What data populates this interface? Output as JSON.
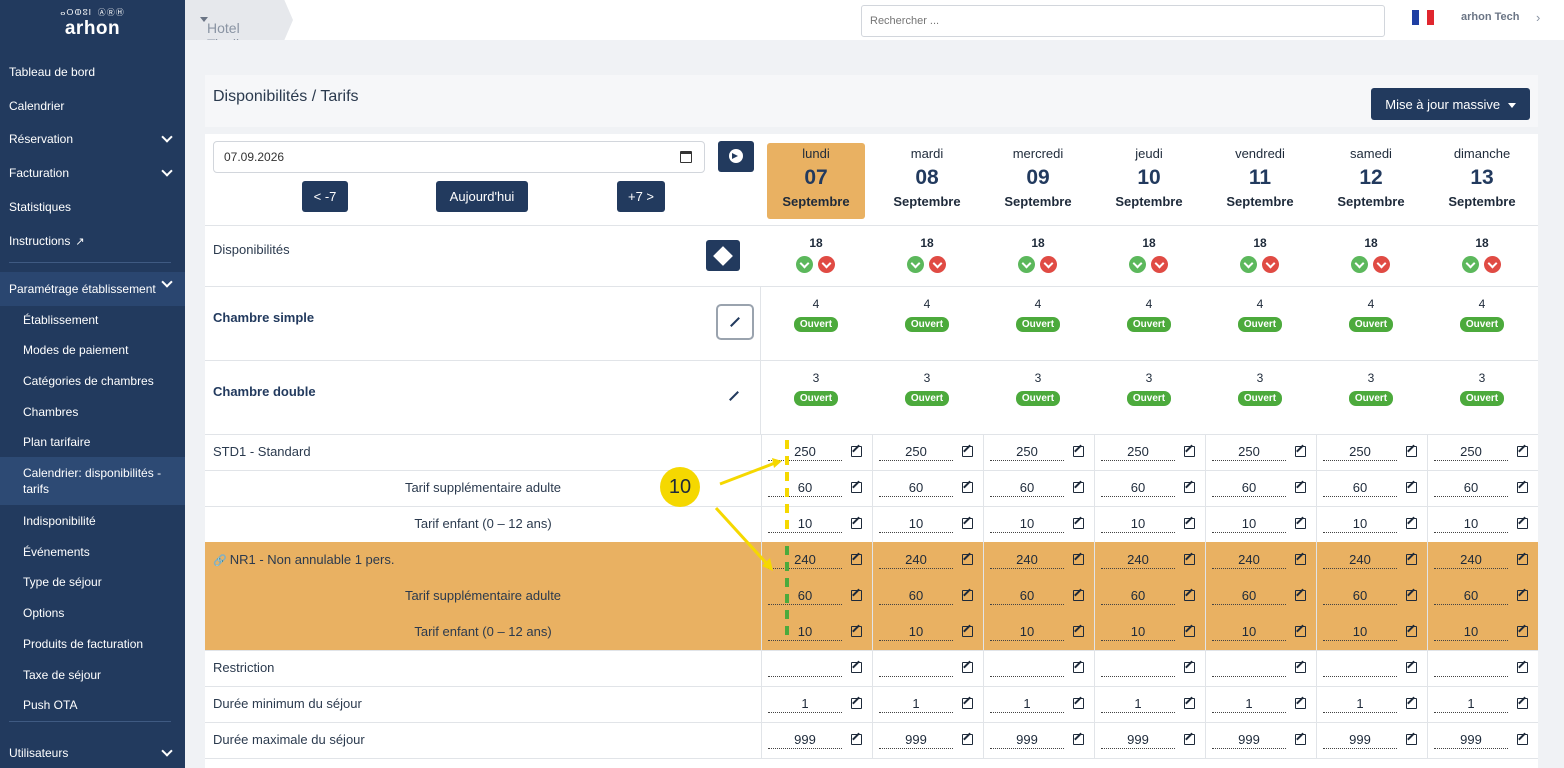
{
  "brand": {
    "mark": "ⴰⵔⵀⵓⵏ ⒶⓇⒽ",
    "name": "arhon"
  },
  "sidebar": {
    "items": [
      {
        "label": "Tableau de bord"
      },
      {
        "label": "Calendrier"
      },
      {
        "label": "Réservation"
      },
      {
        "label": "Facturation"
      },
      {
        "label": "Statistiques"
      },
      {
        "label": "Instructions"
      },
      {
        "label": "Paramétrage établissement"
      },
      {
        "label": "Établissement"
      },
      {
        "label": "Modes de paiement"
      },
      {
        "label": "Catégories de chambres"
      },
      {
        "label": "Chambres"
      },
      {
        "label": "Plan tarifaire"
      },
      {
        "label": "Calendrier: disponibilités - tarifs"
      },
      {
        "label": "Indisponibilité"
      },
      {
        "label": "Événements"
      },
      {
        "label": "Type de séjour"
      },
      {
        "label": "Options"
      },
      {
        "label": "Produits de facturation"
      },
      {
        "label": "Taxe de séjour"
      },
      {
        "label": "Push OTA"
      },
      {
        "label": "Utilisateurs"
      }
    ]
  },
  "topbar": {
    "hotel": "Hotel Tivoli",
    "search_placeholder": "Rechercher ...",
    "user": "arhon Tech",
    "flag_colors": [
      "#1f3fa3",
      "#ffffff",
      "#e0262e"
    ]
  },
  "header": {
    "title": "Disponibilités / Tarifs",
    "mass_update": "Mise à jour massive"
  },
  "controls": {
    "date": "07.09.2026",
    "prev": "< -7",
    "today": "Aujourd'hui",
    "next": "+7 >"
  },
  "days": [
    {
      "name": "lundi",
      "num": "07",
      "month": "Septembre",
      "today": true
    },
    {
      "name": "mardi",
      "num": "08",
      "month": "Septembre"
    },
    {
      "name": "mercredi",
      "num": "09",
      "month": "Septembre"
    },
    {
      "name": "jeudi",
      "num": "10",
      "month": "Septembre"
    },
    {
      "name": "vendredi",
      "num": "11",
      "month": "Septembre"
    },
    {
      "name": "samedi",
      "num": "12",
      "month": "Septembre"
    },
    {
      "name": "dimanche",
      "num": "13",
      "month": "Septembre"
    }
  ],
  "availability": {
    "label": "Disponibilités",
    "values": [
      "18",
      "18",
      "18",
      "18",
      "18",
      "18",
      "18"
    ]
  },
  "rooms": [
    {
      "label": "Chambre simple",
      "counts": [
        "4",
        "4",
        "4",
        "4",
        "4",
        "4",
        "4"
      ],
      "status": "Ouvert"
    },
    {
      "label": "Chambre double",
      "counts": [
        "3",
        "3",
        "3",
        "3",
        "3",
        "3",
        "3"
      ],
      "status": "Ouvert"
    }
  ],
  "rate_rows": [
    {
      "label": "STD1 - Standard",
      "values": [
        "250",
        "250",
        "250",
        "250",
        "250",
        "250",
        "250"
      ],
      "highlight": false,
      "center": false
    },
    {
      "label": "Tarif supplémentaire adulte",
      "values": [
        "60",
        "60",
        "60",
        "60",
        "60",
        "60",
        "60"
      ],
      "highlight": false,
      "center": true
    },
    {
      "label": "Tarif enfant (0 – 12 ans)",
      "values": [
        "10",
        "10",
        "10",
        "10",
        "10",
        "10",
        "10"
      ],
      "highlight": false,
      "center": true
    },
    {
      "label": "NR1 - Non annulable 1 pers.",
      "values": [
        "240",
        "240",
        "240",
        "240",
        "240",
        "240",
        "240"
      ],
      "highlight": true,
      "center": false,
      "link_icon": "link-icon"
    },
    {
      "label": "Tarif supplémentaire adulte",
      "values": [
        "60",
        "60",
        "60",
        "60",
        "60",
        "60",
        "60"
      ],
      "highlight": true,
      "center": true
    },
    {
      "label": "Tarif enfant (0 – 12 ans)",
      "values": [
        "10",
        "10",
        "10",
        "10",
        "10",
        "10",
        "10"
      ],
      "highlight": true,
      "center": true
    },
    {
      "label": "Restriction",
      "values": [
        "",
        "",
        "",
        "",
        "",
        "",
        ""
      ],
      "highlight": false,
      "center": false
    },
    {
      "label": "Durée minimum du séjour",
      "values": [
        "1",
        "1",
        "1",
        "1",
        "1",
        "1",
        "1"
      ],
      "highlight": false,
      "center": false
    },
    {
      "label": "Durée maximale du séjour",
      "values": [
        "999",
        "999",
        "999",
        "999",
        "999",
        "999",
        "999"
      ],
      "highlight": false,
      "center": false
    }
  ],
  "annotation": {
    "number": "10",
    "colors": {
      "yellow": "#f5d800",
      "green": "#4caa3c"
    }
  },
  "colors": {
    "navy": "#223a5e",
    "orange": "#e9b162",
    "green": "#4caa3c",
    "red": "#e04b44"
  }
}
